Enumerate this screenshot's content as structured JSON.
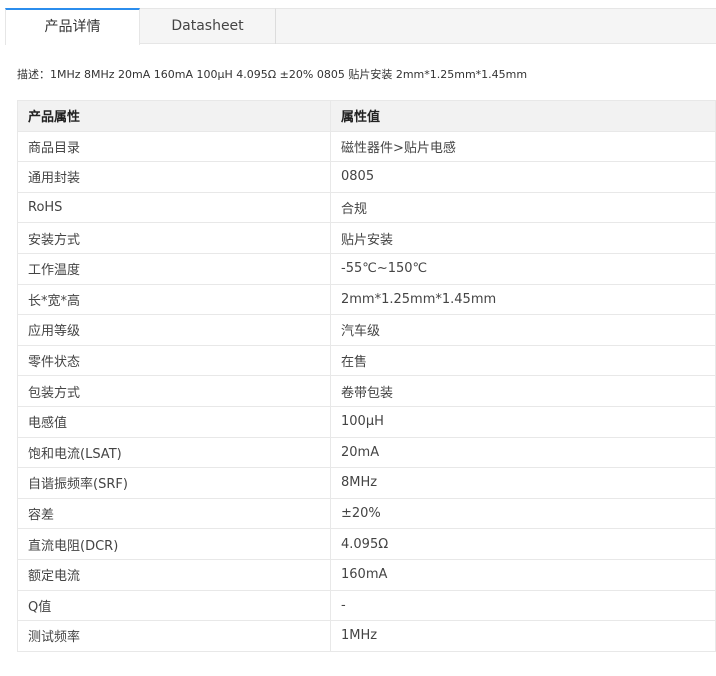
{
  "tabs": [
    {
      "label": "产品详情",
      "active": true
    },
    {
      "label": "Datasheet",
      "active": false
    }
  ],
  "description": "描述：1MHz 8MHz 20mA 160mA 100μH 4.095Ω ±20% 0805 贴片安装 2mm*1.25mm*1.45mm",
  "table": {
    "headers": [
      "产品属性",
      "属性值"
    ],
    "rows": [
      [
        "商品目录",
        "磁性器件>贴片电感"
      ],
      [
        "通用封装",
        "0805"
      ],
      [
        "RoHS",
        "合规"
      ],
      [
        "安装方式",
        "贴片安装"
      ],
      [
        "工作温度",
        "-55℃~150℃"
      ],
      [
        "长*宽*高",
        "2mm*1.25mm*1.45mm"
      ],
      [
        "应用等级",
        "汽车级"
      ],
      [
        "零件状态",
        "在售"
      ],
      [
        "包装方式",
        "卷带包装"
      ],
      [
        "电感值",
        "100μH"
      ],
      [
        "饱和电流(LSAT)",
        "20mA"
      ],
      [
        "自谐振频率(SRF)",
        "8MHz"
      ],
      [
        "容差",
        "±20%"
      ],
      [
        "直流电阻(DCR)",
        "4.095Ω"
      ],
      [
        "额定电流",
        "160mA"
      ],
      [
        "Q值",
        "-"
      ],
      [
        "测试频率",
        "1MHz"
      ]
    ]
  },
  "colors": {
    "accent": "#2b8ded",
    "header_bg": "#f2f2f2",
    "border": "#e8e8e8"
  }
}
